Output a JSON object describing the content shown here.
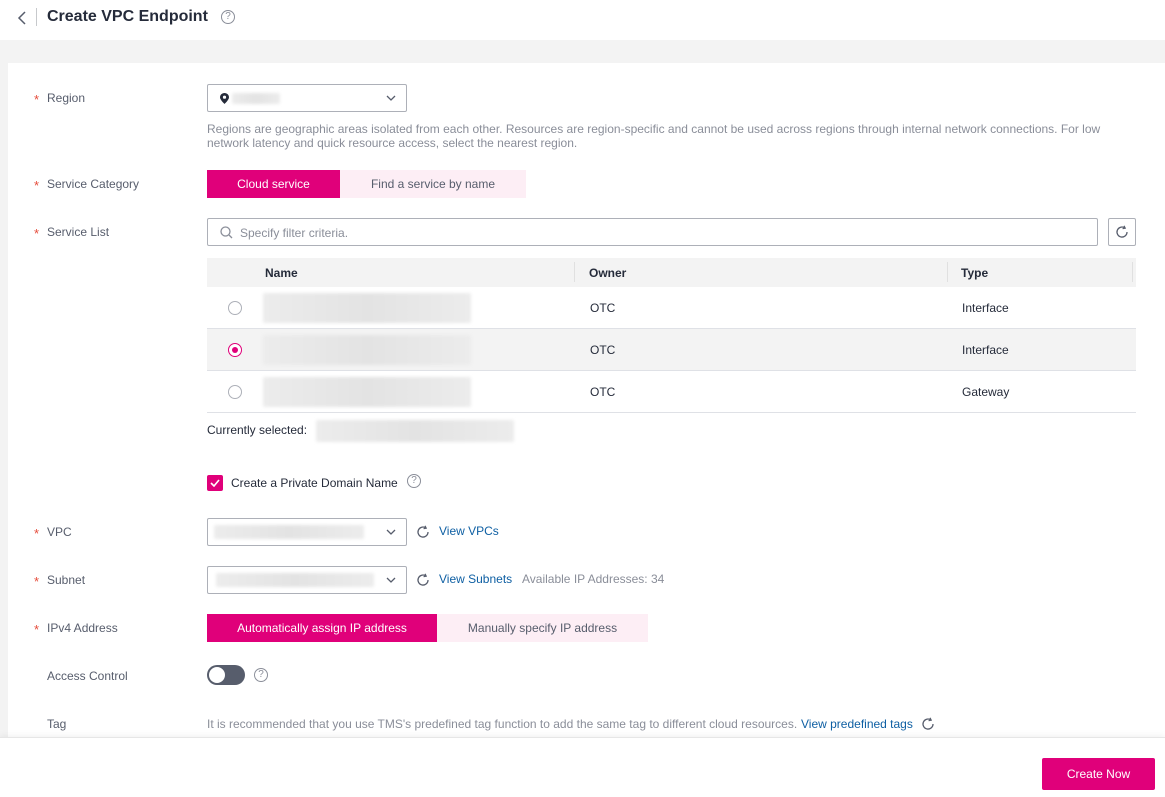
{
  "header": {
    "title": "Create VPC Endpoint"
  },
  "form": {
    "region": {
      "label": "Region",
      "hint": "Regions are geographic areas isolated from each other. Resources are region-specific and cannot be used across regions through internal network connections. For low network latency and quick resource access, select the nearest region."
    },
    "service_category": {
      "label": "Service Category",
      "options": [
        "Cloud service",
        "Find a service by name"
      ],
      "selected": "Cloud service"
    },
    "service_list": {
      "label": "Service List",
      "search_placeholder": "Specify filter criteria.",
      "columns": [
        "Name",
        "Owner",
        "Type"
      ],
      "rows": [
        {
          "owner": "OTC",
          "type": "Interface",
          "selected": false
        },
        {
          "owner": "OTC",
          "type": "Interface",
          "selected": true
        },
        {
          "owner": "OTC",
          "type": "Gateway",
          "selected": false
        }
      ],
      "currently_selected_label": "Currently selected:"
    },
    "private_domain": {
      "label": "Create a Private Domain Name",
      "checked": true
    },
    "vpc": {
      "label": "VPC",
      "link": "View VPCs"
    },
    "subnet": {
      "label": "Subnet",
      "link": "View Subnets",
      "available": "Available IP Addresses: 34"
    },
    "ipv4": {
      "label": "IPv4 Address",
      "options": [
        "Automatically assign IP address",
        "Manually specify IP address"
      ],
      "selected": "Automatically assign IP address"
    },
    "access_control": {
      "label": "Access Control",
      "enabled": false
    },
    "tag": {
      "label": "Tag",
      "hint": "It is recommended that you use TMS's predefined tag function to add the same tag to different cloud resources.",
      "link": "View predefined tags"
    }
  },
  "footer": {
    "create_label": "Create Now"
  },
  "colors": {
    "accent": "#e0007a",
    "link": "#0e5fa3",
    "required": "#e64c3b"
  }
}
